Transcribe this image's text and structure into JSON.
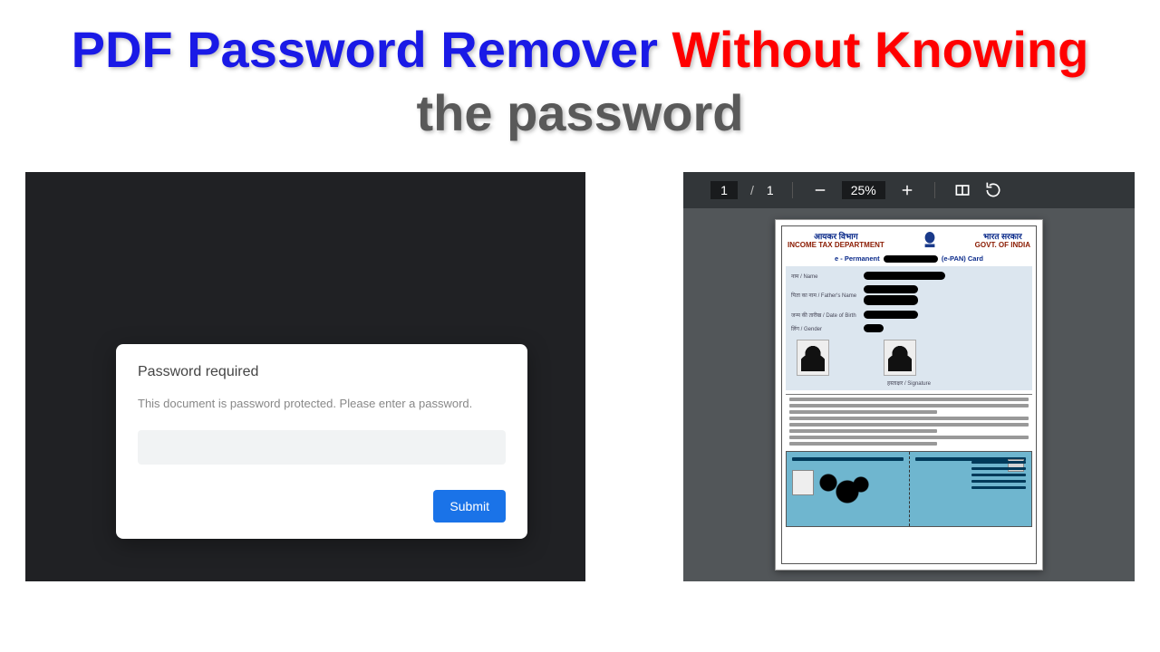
{
  "title": {
    "seg1": "PDF Password Remover ",
    "seg2": "Without Knowing ",
    "seg3": "the password"
  },
  "locked_dialog": {
    "heading": "Password required",
    "message": "This document is password protected. Please enter a password.",
    "input_value": "",
    "submit_label": "Submit"
  },
  "viewer": {
    "page_current": "1",
    "page_sep": "/",
    "page_total": "1",
    "zoom": "25%"
  },
  "document": {
    "header": {
      "left_hindi": "आयकर विभाग",
      "left_eng": "INCOME TAX DEPARTMENT",
      "right_hindi": "भारत सरकार",
      "right_eng": "GOVT. OF INDIA"
    },
    "subtitle_prefix": "e - Permanent",
    "subtitle_suffix": "(e-PAN) Card",
    "labels": {
      "name": "नाम / Name",
      "father": "पिता का नाम / Father's Name",
      "dob": "जन्म की तारीख / Date of Birth",
      "gender": "लिंग / Gender",
      "signature": "हस्ताक्षर / Signature"
    }
  }
}
